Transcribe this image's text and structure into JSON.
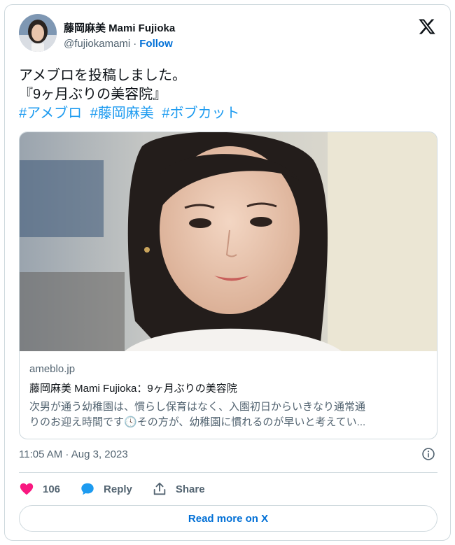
{
  "user": {
    "display_name": "藤岡麻美 Mami Fujioka",
    "handle": "@fujiokamami",
    "separator": "·",
    "follow_label": "Follow"
  },
  "tweet": {
    "line1": "アメブロを投稿しました。",
    "line2": "『9ヶ月ぶりの美容院』",
    "hashtags": [
      "#アメブロ",
      "#藤岡麻美",
      "#ボブカット"
    ]
  },
  "link_card": {
    "domain": "ameblo.jp",
    "title": "藤岡麻美 Mami Fujioka：9ヶ月ぶりの美容院",
    "description_line1": "次男が通う幼稚園は、慣らし保育はなく、入園初日からいきなり通常通",
    "description_line2a": "りのお迎え時間です",
    "description_line2b": "その方が、幼稚園に慣れるのが早いと考えてい..."
  },
  "timestamp": "11:05 AM · Aug 3, 2023",
  "actions": {
    "like_count": "106",
    "reply_label": "Reply",
    "share_label": "Share"
  },
  "read_more_label": "Read more on X",
  "icons": {
    "like": "heart-icon",
    "reply": "speech-bubble-icon",
    "share": "share-upload-icon",
    "info": "info-icon",
    "logo": "x-logo-icon",
    "clock": "clock-emoji-icon"
  },
  "colors": {
    "link_blue": "#1d9bf0",
    "follow_blue": "#006fd6",
    "heart_pink": "#f91880",
    "reply_blue": "#1d9bf0",
    "muted_text": "#536471",
    "border": "#cfd9de"
  }
}
